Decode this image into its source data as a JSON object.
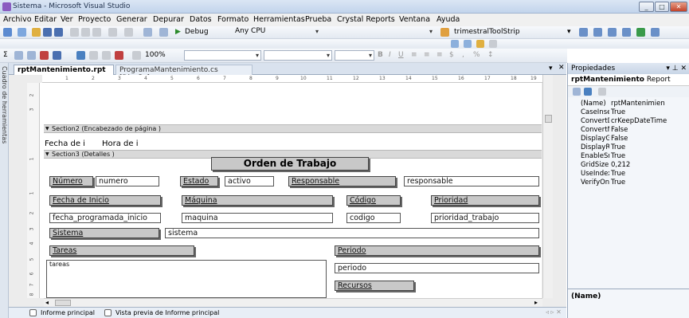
{
  "window": {
    "title": "Sistema - Microsoft Visual Studio"
  },
  "menu": [
    "Archivo",
    "Editar",
    "Ver",
    "Proyecto",
    "Generar",
    "Depurar",
    "Datos",
    "Formato",
    "Herramientas",
    "Prueba",
    "Crystal Reports",
    "Ventana",
    "Ayuda"
  ],
  "toolbar": {
    "config": "Debug",
    "platform": "Any CPU",
    "strip_combo": "trimestralToolStrip",
    "zoom": "100%"
  },
  "side_panel": {
    "label": "Cuadro de herramientas"
  },
  "doc_tabs": [
    "rptMantenimiento.rpt",
    "ProgramaMantenimiento.cs [Diseño]"
  ],
  "ruler_marks": [
    "1",
    "2",
    "3",
    "4",
    "5",
    "6",
    "7",
    "8",
    "9",
    "10",
    "11",
    "12",
    "13",
    "14",
    "15",
    "16",
    "17",
    "18",
    "19"
  ],
  "vruler_marks": [
    "2",
    "3",
    "1",
    "1",
    "2",
    "3",
    "4",
    "5",
    "6",
    "7",
    "8"
  ],
  "report": {
    "section2": "Section2 (Encabezado de página )",
    "section3": "Section3 (Detalles )",
    "fecha_de": "Fecha de i",
    "hora_de": "Hora de i",
    "title": "Orden de Trabajo",
    "lbl_numero": "Número",
    "fld_numero": "numero",
    "lbl_estado": "Estado",
    "fld_estado": "activo",
    "lbl_responsable": "Responsable",
    "fld_responsable": "responsable",
    "lbl_fecha_inicio": "Fecha de Inicio",
    "lbl_maquina": "Máquina",
    "lbl_codigo": "Código",
    "lbl_prioridad": "Prioridad",
    "fld_fecha": "fecha_programada_inicio",
    "fld_maquina": "maquina",
    "fld_codigo": "codigo",
    "fld_prioridad": "prioridad_trabajo",
    "lbl_sistema": "Sistema",
    "fld_sistema": "sistema",
    "lbl_tareas": "Tareas",
    "lbl_periodo": "Periodo",
    "fld_tareas": "tareas",
    "fld_periodo": "periodo",
    "lbl_recursos": "Recursos"
  },
  "bottom_tabs": [
    "Informe principal",
    "Vista previa de Informe principal"
  ],
  "properties": {
    "header": "Propiedades",
    "object": "rptMantenimiento",
    "object_type": "Report",
    "rows": [
      {
        "name": "(Name)",
        "value": "rptMantenimien"
      },
      {
        "name": "CaseInsens",
        "value": "True"
      },
      {
        "name": "ConvertDat",
        "value": "crKeepDateTime"
      },
      {
        "name": "ConvertNu",
        "value": "False"
      },
      {
        "name": "DisplayGric",
        "value": "False"
      },
      {
        "name": "DisplayRule",
        "value": "True"
      },
      {
        "name": "EnableSnap",
        "value": "True"
      },
      {
        "name": "GridSize",
        "value": "0,212"
      },
      {
        "name": "UseIndexFc",
        "value": "True"
      },
      {
        "name": "VerifyOnEv",
        "value": "True"
      }
    ],
    "desc_title": "(Name)"
  }
}
